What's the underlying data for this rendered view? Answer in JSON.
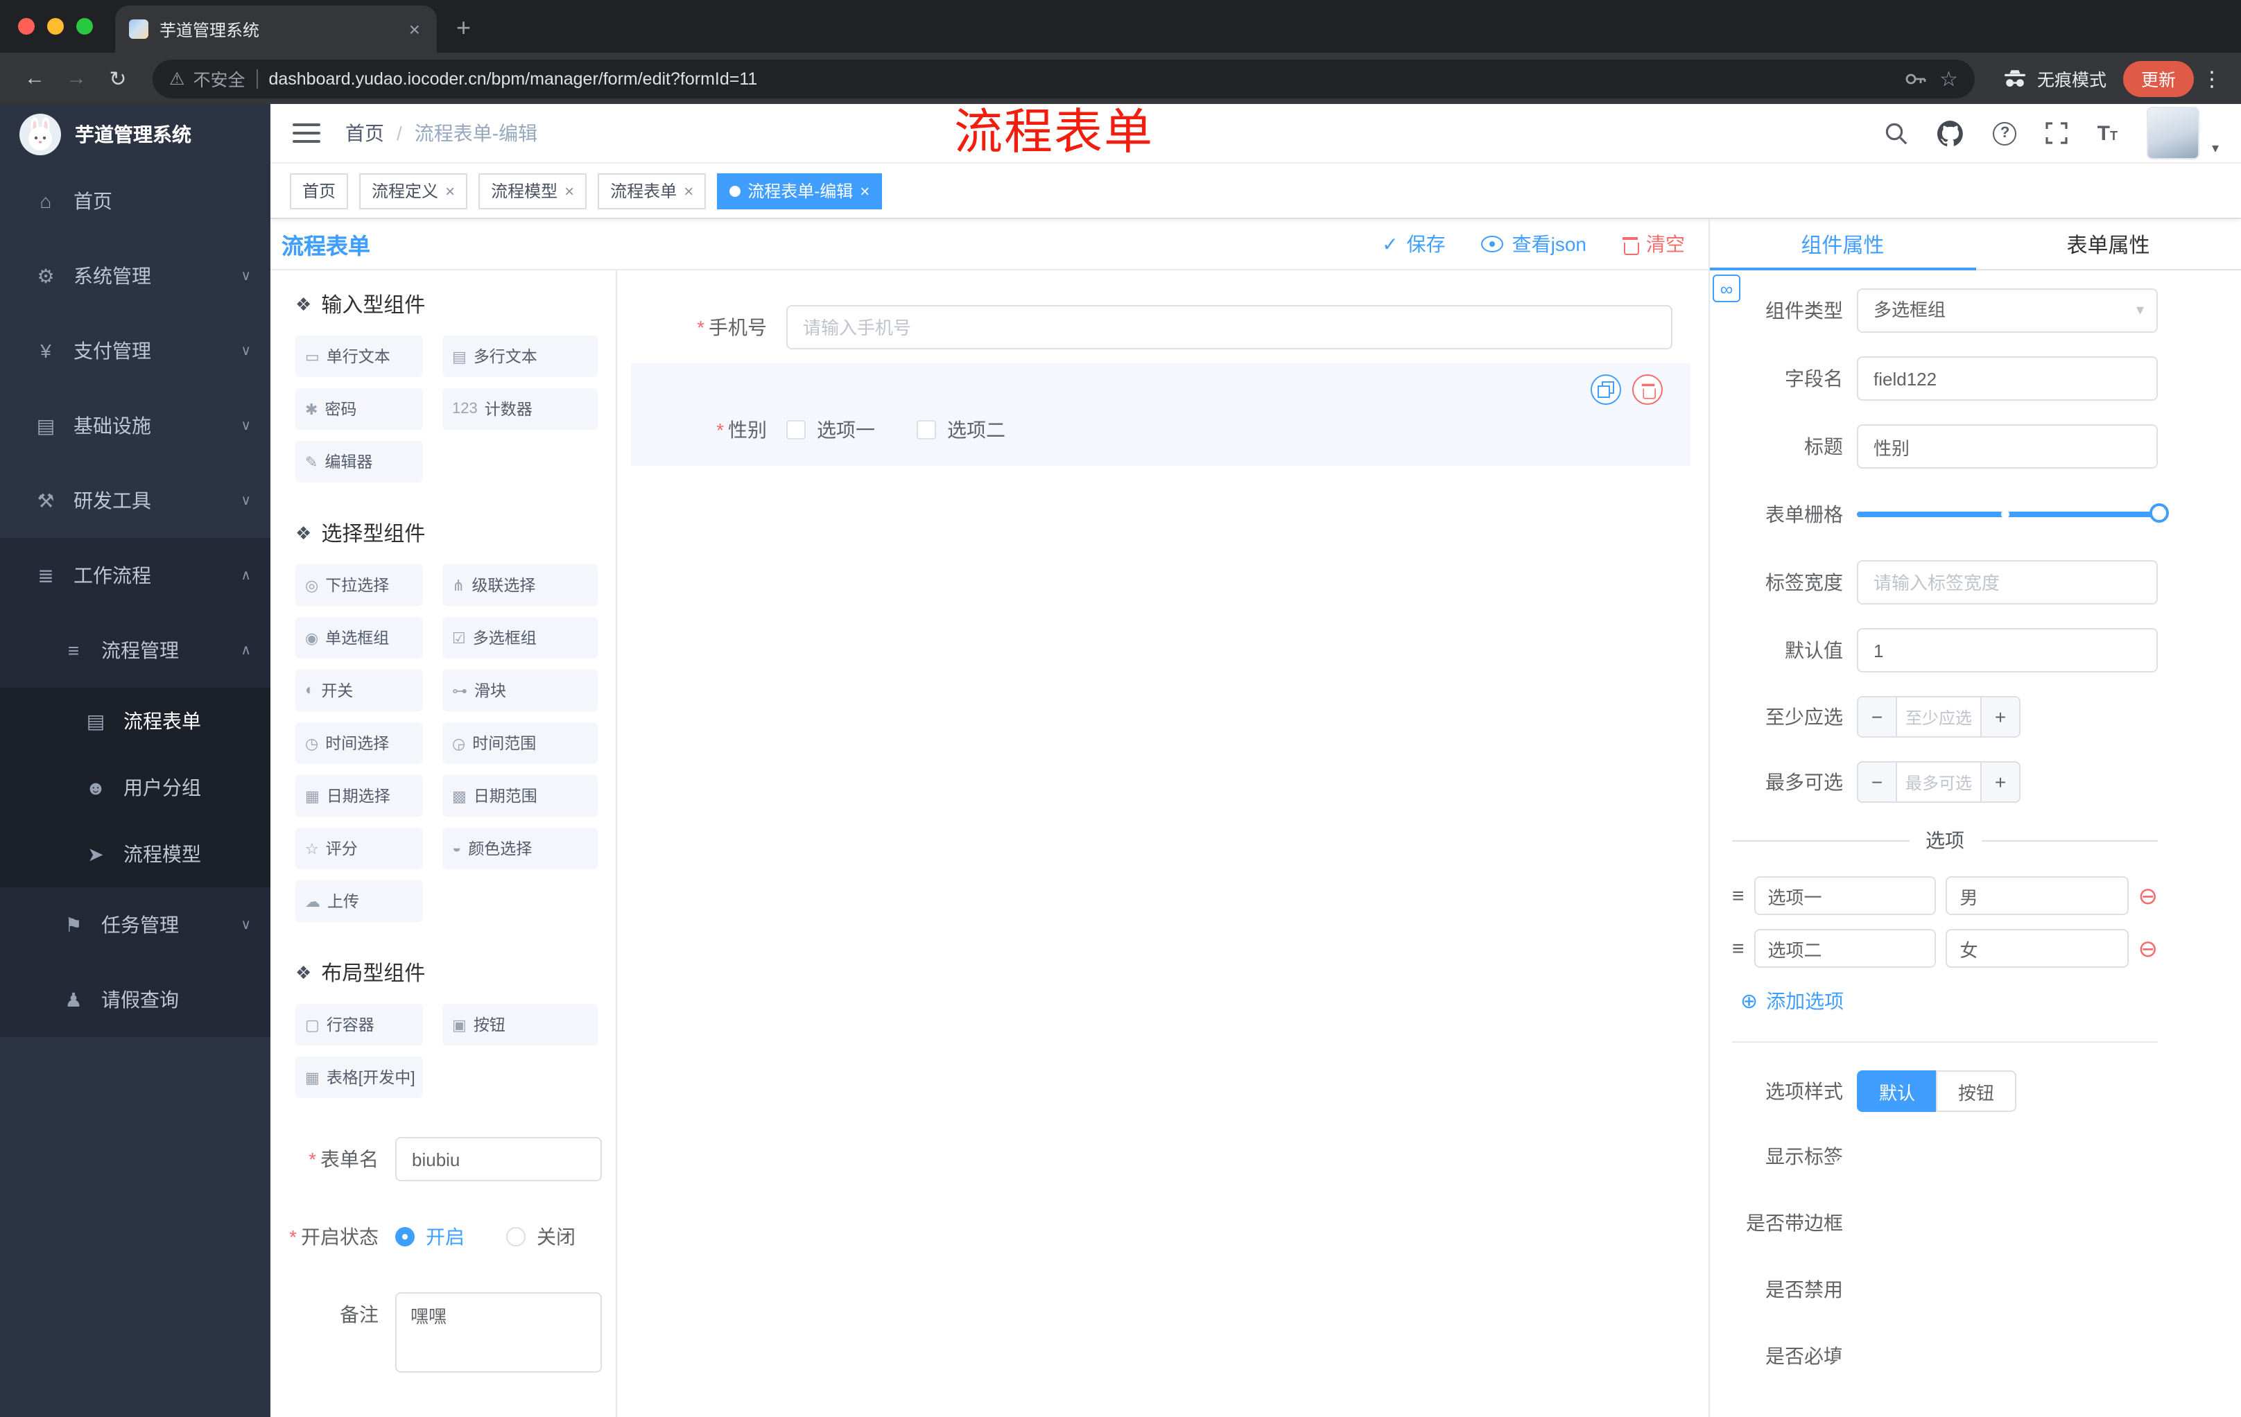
{
  "browser": {
    "tab_title": "芋道管理系统",
    "security_label": "不安全",
    "url": "dashboard.yudao.iocoder.cn/bpm/manager/form/edit?formId=11",
    "incognito_label": "无痕模式",
    "update_label": "更新"
  },
  "annotation": "流程表单",
  "header": {
    "breadcrumb_home": "首页",
    "breadcrumb_current": "流程表单-编辑"
  },
  "sidebar": {
    "app_title": "芋道管理系统",
    "items": [
      {
        "label": "首页",
        "glyph": "⌂"
      },
      {
        "label": "系统管理",
        "glyph": "⚙"
      },
      {
        "label": "支付管理",
        "glyph": "¥"
      },
      {
        "label": "基础设施",
        "glyph": "▤"
      },
      {
        "label": "研发工具",
        "glyph": "⚒"
      },
      {
        "label": "工作流程",
        "glyph": "≣"
      },
      {
        "label": "流程管理",
        "glyph": "≡"
      },
      {
        "label": "流程表单",
        "glyph": "▤"
      },
      {
        "label": "用户分组",
        "glyph": "☻"
      },
      {
        "label": "流程模型",
        "glyph": "➤"
      },
      {
        "label": "任务管理",
        "glyph": "⚑"
      },
      {
        "label": "请假查询",
        "glyph": "♟"
      }
    ]
  },
  "tags": [
    {
      "label": "首页"
    },
    {
      "label": "流程定义"
    },
    {
      "label": "流程模型"
    },
    {
      "label": "流程表单"
    },
    {
      "label": "流程表单-编辑"
    }
  ],
  "page": {
    "title": "流程表单",
    "save": "保存",
    "view_json": "查看json",
    "clear": "清空"
  },
  "palette": {
    "sections": [
      {
        "title": "输入型组件",
        "items": [
          {
            "label": "单行文本",
            "glyph": "▭"
          },
          {
            "label": "多行文本",
            "glyph": "▤"
          },
          {
            "label": "密码",
            "glyph": "✱"
          },
          {
            "label": "计数器",
            "glyph": "123"
          },
          {
            "label": "编辑器",
            "glyph": "✎"
          }
        ]
      },
      {
        "title": "选择型组件",
        "items": [
          {
            "label": "下拉选择",
            "glyph": "◎"
          },
          {
            "label": "级联选择",
            "glyph": "⋔"
          },
          {
            "label": "单选框组",
            "glyph": "◉"
          },
          {
            "label": "多选框组",
            "glyph": "☑"
          },
          {
            "label": "开关",
            "glyph": "◐"
          },
          {
            "label": "滑块",
            "glyph": "⊶"
          },
          {
            "label": "时间选择",
            "glyph": "◷"
          },
          {
            "label": "时间范围",
            "glyph": "◶"
          },
          {
            "label": "日期选择",
            "glyph": "▦"
          },
          {
            "label": "日期范围",
            "glyph": "▩"
          },
          {
            "label": "评分",
            "glyph": "☆"
          },
          {
            "label": "颜色选择",
            "glyph": "◒"
          },
          {
            "label": "上传",
            "glyph": "☁"
          }
        ]
      },
      {
        "title": "布局型组件",
        "items": [
          {
            "label": "行容器",
            "glyph": "▢"
          },
          {
            "label": "按钮",
            "glyph": "▣"
          },
          {
            "label": "表格[开发中]",
            "glyph": "▦"
          }
        ]
      }
    ],
    "form": {
      "name_label": "表单名",
      "name_value": "biubiu",
      "status_label": "开启状态",
      "status_on": "开启",
      "status_off": "关闭",
      "remark_label": "备注",
      "remark_value": "嘿嘿"
    }
  },
  "canvas": {
    "phone": {
      "label": "手机号",
      "placeholder": "请输入手机号"
    },
    "gender": {
      "label": "性别",
      "option1": "选项一",
      "option2": "选项二"
    }
  },
  "properties": {
    "tab_component": "组件属性",
    "tab_form": "表单属性",
    "rows": {
      "component_type_label": "组件类型",
      "component_type_value": "多选框组",
      "field_name_label": "字段名",
      "field_name_value": "field122",
      "title_label": "标题",
      "title_value": "性别",
      "grid_label": "表单栅格",
      "label_width_label": "标签宽度",
      "label_width_placeholder": "请输入标签宽度",
      "default_label": "默认值",
      "default_value": "1",
      "min_label": "至少应选",
      "min_placeholder": "至少应选",
      "max_label": "最多可选",
      "max_placeholder": "最多可选"
    },
    "options_title": "选项",
    "options": [
      {
        "label": "选项一",
        "value": "男"
      },
      {
        "label": "选项二",
        "value": "女"
      }
    ],
    "add_option": "添加选项",
    "style_label": "选项样式",
    "style_default": "默认",
    "style_button": "按钮",
    "toggles": [
      {
        "label": "显示标签",
        "on": true
      },
      {
        "label": "是否带边框",
        "on": false
      },
      {
        "label": "是否禁用",
        "on": false
      },
      {
        "label": "是否必填",
        "on": true
      }
    ]
  },
  "icons": {
    "close": "×",
    "new_tab": "+",
    "back": "←",
    "forward": "→",
    "reload": "↻",
    "warning": "⚠",
    "star": "☆",
    "menu_kebab": "⋮",
    "caret_down": "▾",
    "chevron_down": "∨",
    "chevron_up": "∧",
    "breadcrumb_sep": "/",
    "check": "✓",
    "remove_circle": "⊖",
    "add_circle": "⊕",
    "drag_handle": "≡",
    "link": "∞",
    "select_arrow": "▾",
    "minus": "−",
    "plus": "+",
    "question": "?",
    "section_diamond": "❖",
    "font_large": "T",
    "font_small": "T"
  },
  "colors": {
    "primary": "#409eff",
    "danger": "#f56c6c",
    "annotation_red": "#f21d0e",
    "sidebar_bg": "#2c3343",
    "sidebar_bg_dark": "#232937",
    "sidebar_bg_darker": "#1b2029",
    "active_tag_bg": "#409eff"
  }
}
